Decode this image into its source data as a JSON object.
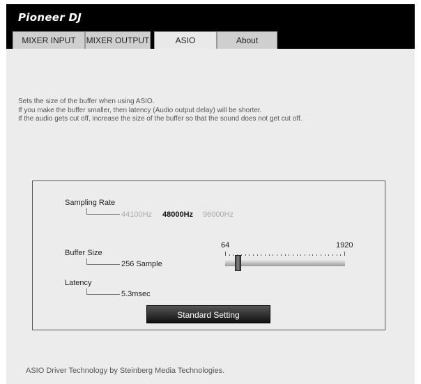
{
  "app": {
    "logo": "Pioneer DJ"
  },
  "tabs": [
    {
      "label": "MIXER INPUT"
    },
    {
      "label": "MIXER OUTPUT"
    },
    {
      "label": "ASIO",
      "active": true
    },
    {
      "label": "About"
    }
  ],
  "description": {
    "line1": "Sets the size of the buffer when using ASIO.",
    "line2": "If you make the buffer smaller, then latency (Audio output delay) will be shorter.",
    "line3": "If the audio gets cut off, increase the size of the buffer so that the sound does not get cut off."
  },
  "sampling_rate": {
    "label": "Sampling Rate",
    "options": [
      "44100Hz",
      "48000Hz",
      "96000Hz"
    ],
    "selected": "48000Hz"
  },
  "buffer_size": {
    "label": "Buffer Size",
    "value": "256 Sample",
    "slider_min": "64",
    "slider_max": "1920"
  },
  "latency": {
    "label": "Latency",
    "value": "5.3msec"
  },
  "standard_setting_label": "Standard Setting",
  "footer": "ASIO Driver Technology by Steinberg Media Technologies.",
  "colors": {
    "header_bg": "#000000",
    "panel_bg": "#ececec",
    "button_bg": "#222222"
  }
}
